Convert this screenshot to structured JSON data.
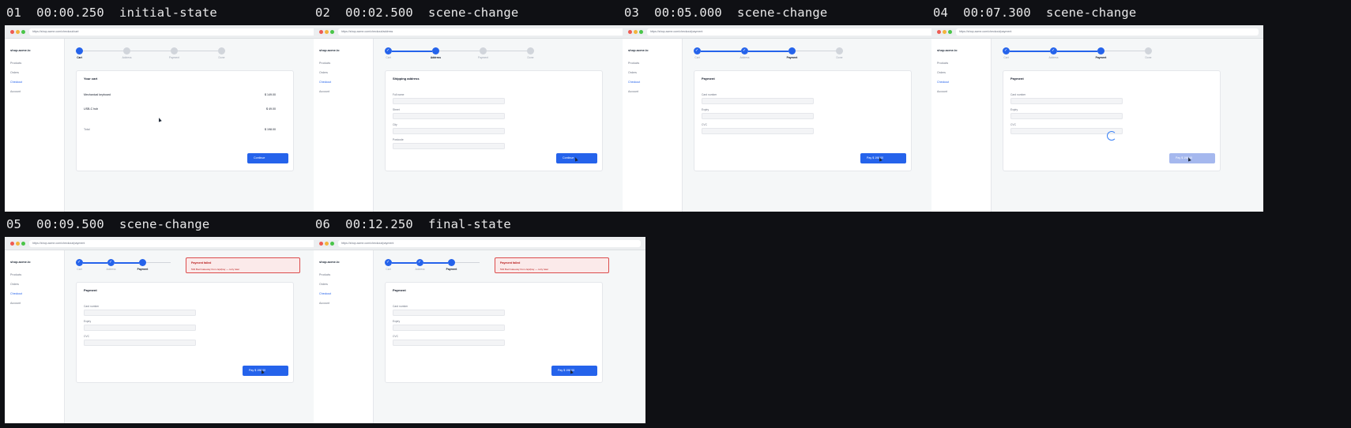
{
  "frames": [
    {
      "num": "01",
      "time": "00:00.250",
      "event": "initial-state",
      "url": "https://shop.acme.com/checkout/cart",
      "screen": "cart",
      "step": 1,
      "cursor": true
    },
    {
      "num": "02",
      "time": "00:02.500",
      "event": "scene-change",
      "url": "https://shop.acme.com/checkout/address",
      "screen": "address",
      "step": 2,
      "cursor": true
    },
    {
      "num": "03",
      "time": "00:05.000",
      "event": "scene-change",
      "url": "https://shop.acme.com/checkout/payment",
      "screen": "payment",
      "step": 3,
      "cursor": true
    },
    {
      "num": "04",
      "time": "00:07.300",
      "event": "scene-change",
      "url": "https://shop.acme.com/checkout/payment",
      "screen": "payment-loading",
      "step": 3,
      "cursor": true
    },
    {
      "num": "05",
      "time": "00:09.500",
      "event": "scene-change",
      "url": "https://shop.acme.com/checkout/payment",
      "screen": "payment-error",
      "step": 3,
      "cursor": true
    },
    {
      "num": "06",
      "time": "00:12.250",
      "event": "final-state",
      "url": "https://shop.acme.com/checkout/payment",
      "screen": "payment-error",
      "step": 3,
      "cursor": true
    }
  ],
  "app": {
    "brand": "shop.acme.io",
    "nav": [
      "Products",
      "Orders",
      "Checkout",
      "Account"
    ],
    "active_nav": "Checkout",
    "steps": [
      "Cart",
      "Address",
      "Payment",
      "Done"
    ]
  },
  "cart": {
    "title": "Your cart",
    "items": [
      {
        "name": "Mechanical keyboard",
        "price": "$ 149.00"
      },
      {
        "name": "USB-C hub",
        "price": "$ 49.00"
      }
    ],
    "total_label": "Total",
    "total_value": "$ 198.00",
    "button": "Continue"
  },
  "address": {
    "title": "Shipping address",
    "fields": [
      "Full name",
      "Street",
      "City",
      "Postcode"
    ],
    "button": "Continue"
  },
  "payment": {
    "title": "Payment",
    "fields": [
      "Card number",
      "Expiry",
      "CVC"
    ],
    "button": "Pay $ 198.00"
  },
  "error": {
    "title": "Payment failed",
    "text": "502 Bad Gateway from /api/pay — retry later"
  },
  "colors": {
    "accent": "#2563eb",
    "error": "#dc4c4c",
    "background": "#0f1014"
  }
}
